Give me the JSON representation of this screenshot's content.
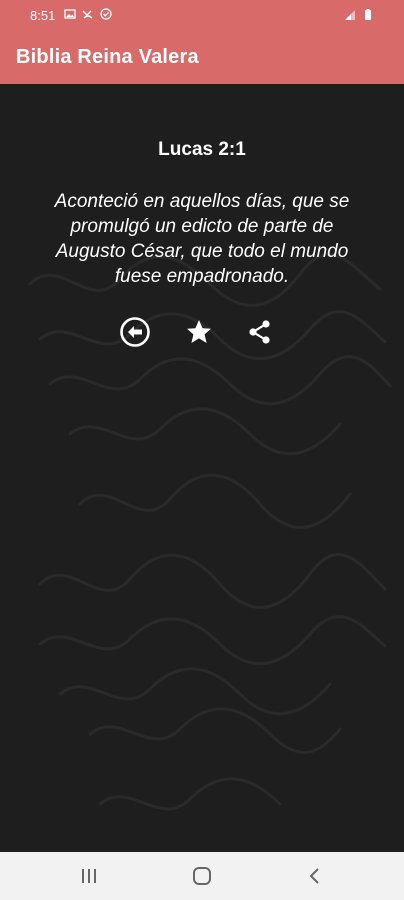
{
  "status_bar": {
    "time": "8:51",
    "icons_left": [
      "image-icon",
      "missed-call-icon",
      "vpn-icon"
    ],
    "icons_right": [
      "signal-icon",
      "battery-icon"
    ]
  },
  "app_bar": {
    "title": "Biblia Reina Valera"
  },
  "verse": {
    "reference": "Lucas 2:1",
    "text": "Aconteció en aquellos días, que se promulgó un edicto de parte de Augusto César, que todo el mundo fuese empadronado."
  },
  "actions": [
    {
      "name": "back-circle-icon"
    },
    {
      "name": "star-icon"
    },
    {
      "name": "share-icon"
    }
  ],
  "nav_bar": {
    "buttons": [
      "recents-icon",
      "home-icon",
      "back-icon"
    ]
  },
  "colors": {
    "accent": "#d96a6a",
    "background": "#1e1e1e",
    "text": "#ffffff",
    "nav_bar": "#f2f2f2"
  }
}
